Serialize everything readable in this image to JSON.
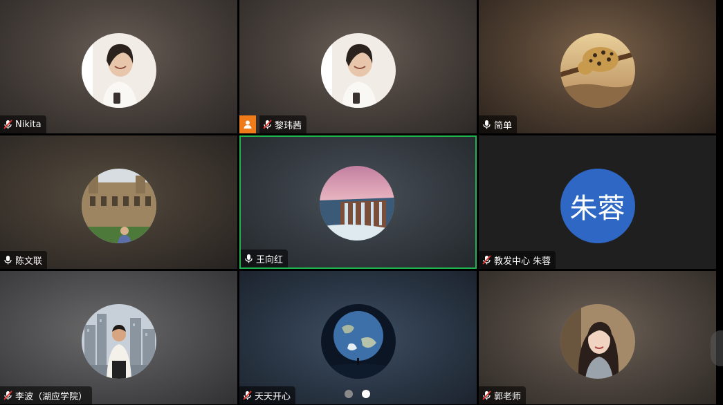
{
  "participants": [
    {
      "name": "Nikita",
      "mic": "muted",
      "avatar": "photo-person-smiling-icon"
    },
    {
      "name": "黎玮茜",
      "mic": "muted",
      "host": true,
      "avatar": "photo-person-smiling-icon"
    },
    {
      "name": "简单",
      "mic": "on",
      "avatar": "photo-leopard-on-branch-icon"
    },
    {
      "name": "陈文联",
      "mic": "on",
      "avatar": "photo-person-in-front-of-building-icon"
    },
    {
      "name": "王向红",
      "mic": "on",
      "active_speaker": true,
      "avatar": "photo-waterfall-landscape-icon"
    },
    {
      "name": "教发中心 朱蓉",
      "mic": "muted",
      "avatar_text": "朱蓉",
      "avatar_color": "#2e68c4"
    },
    {
      "name": "李波（湖应学院）",
      "mic": "muted",
      "avatar": "photo-man-in-city-icon"
    },
    {
      "name": "天天开心",
      "mic": "muted",
      "avatar": "photo-earth-from-space-icon"
    },
    {
      "name": "郭老师",
      "mic": "muted",
      "avatar": "photo-woman-portrait-icon"
    }
  ],
  "pagination": {
    "total_pages": 2,
    "current_page": 2
  },
  "colors": {
    "active_border": "#1fb44f",
    "host_badge": "#f07b1b",
    "mute_red": "#e5322d"
  }
}
